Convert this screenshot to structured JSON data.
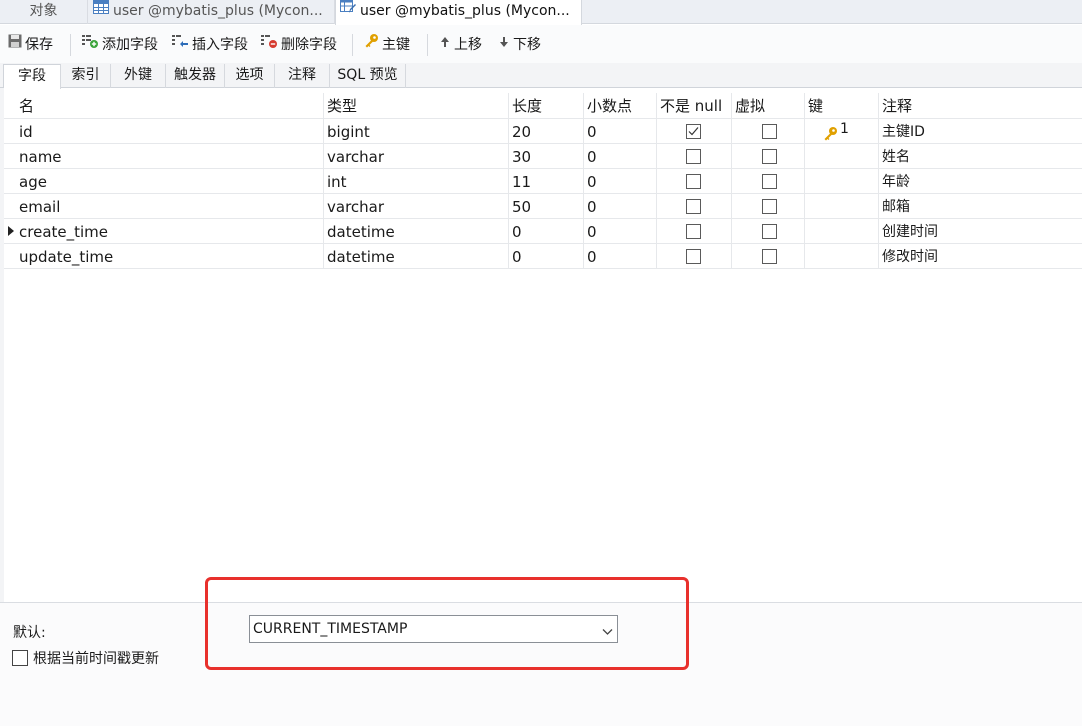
{
  "doc_tabs": [
    {
      "label": "对象",
      "icon": "none"
    },
    {
      "label": "user @mybatis_plus (Mycon...",
      "icon": "table-icon"
    },
    {
      "label": "user @mybatis_plus (Mycon...",
      "icon": "table-design-icon"
    }
  ],
  "toolbar": {
    "save": "保存",
    "add_field": "添加字段",
    "insert_field": "插入字段",
    "delete_field": "删除字段",
    "primary_key": "主键",
    "move_up": "上移",
    "move_down": "下移"
  },
  "subtabs": [
    "字段",
    "索引",
    "外键",
    "触发器",
    "选项",
    "注释",
    "SQL 预览"
  ],
  "columns": [
    "名",
    "类型",
    "长度",
    "小数点",
    "不是 null",
    "虚拟",
    "键",
    "注释"
  ],
  "rows": [
    {
      "name": "id",
      "type": "bigint",
      "length": "20",
      "decimal": "0",
      "not_null": true,
      "virtual": false,
      "key": "1",
      "comment": "主键ID"
    },
    {
      "name": "name",
      "type": "varchar",
      "length": "30",
      "decimal": "0",
      "not_null": false,
      "virtual": false,
      "key": "",
      "comment": "姓名"
    },
    {
      "name": "age",
      "type": "int",
      "length": "11",
      "decimal": "0",
      "not_null": false,
      "virtual": false,
      "key": "",
      "comment": "年龄"
    },
    {
      "name": "email",
      "type": "varchar",
      "length": "50",
      "decimal": "0",
      "not_null": false,
      "virtual": false,
      "key": "",
      "comment": "邮箱"
    },
    {
      "name": "create_time",
      "type": "datetime",
      "length": "0",
      "decimal": "0",
      "not_null": false,
      "virtual": false,
      "key": "",
      "comment": "创建时间",
      "current": true
    },
    {
      "name": "update_time",
      "type": "datetime",
      "length": "0",
      "decimal": "0",
      "not_null": false,
      "virtual": false,
      "key": "",
      "comment": "修改时间"
    }
  ],
  "bottom": {
    "default_label": "默认:",
    "default_value": "CURRENT_TIMESTAMP",
    "update_on_timestamp_label": "根据当前时间戳更新",
    "update_on_timestamp_checked": false
  },
  "colors": {
    "highlight": "#e8302c",
    "key_icon": "#e0a000"
  }
}
